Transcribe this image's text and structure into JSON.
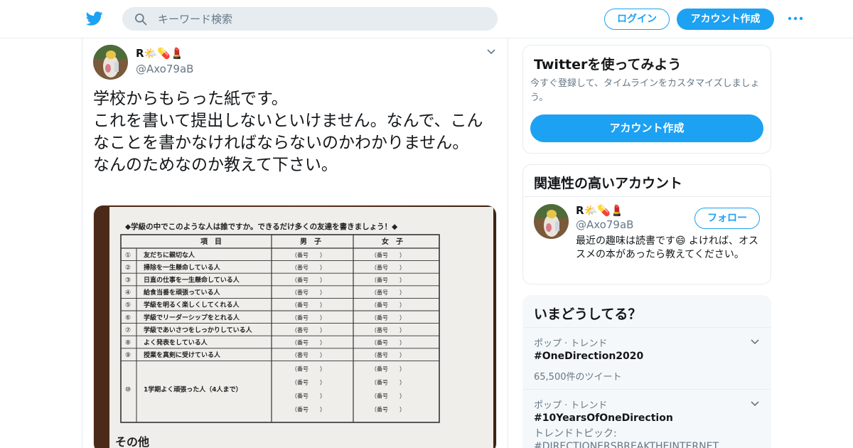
{
  "topbar": {
    "search_placeholder": "キーワード検索",
    "login_label": "ログイン",
    "signup_label": "アカウント作成"
  },
  "tweet": {
    "display_name": "R",
    "display_emojis": "🌤️💊💄",
    "handle": "@Axo79aB",
    "text": "学校からもらった紙です。\nこれを書いて提出しないといけません。なんで、こんなことを書かなければならないのかわかりません。\nなんのためなのか教えて下さい。",
    "media": {
      "title": "◆学級の中でこのような人は誰ですか。できるだけ多くの友達を書きましょう！◆",
      "col_item": "項　目",
      "col_boys": "男　子",
      "col_girls": "女　子",
      "num_label": "（番号　　）",
      "rows": [
        {
          "no": "①",
          "item": "友だちに親切な人"
        },
        {
          "no": "②",
          "item": "掃除を一生懸命している人"
        },
        {
          "no": "③",
          "item": "日直の仕事を一生懸命している人"
        },
        {
          "no": "④",
          "item": "給食当番を頑張っている人"
        },
        {
          "no": "⑤",
          "item": "学級を明るく楽しくしてくれる人"
        },
        {
          "no": "⑥",
          "item": "学級でリーダーシップをとれる人"
        },
        {
          "no": "⑦",
          "item": "学級であいさつをしっかりしている人"
        },
        {
          "no": "⑧",
          "item": "よく発表をしている人"
        },
        {
          "no": "⑨",
          "item": "授業を真剣に受けている人"
        },
        {
          "no": "⑩",
          "item": "1学期よく頑張った人（4人まで）"
        }
      ],
      "footer": "その他"
    }
  },
  "sidebar": {
    "signup_card": {
      "title": "Twitterを使ってみよう",
      "desc": "今すぐ登録して、タイムラインをカスタマイズしましょう。",
      "button": "アカウント作成"
    },
    "related_card": {
      "title": "関連性の高いアカウント",
      "name": "R",
      "emojis": "🌤️💊💄",
      "handle": "@Axo79aB",
      "follow": "フォロー",
      "bio": "最近の趣味は読書です😄 よければ、オススメの本があったら教えてください。"
    },
    "trends": {
      "title": "いまどうしてる？",
      "items": [
        {
          "context": "ポップ · トレンド",
          "name": "#OneDirection2020",
          "count": "65,500件のツイート"
        },
        {
          "context": "ポップ · トレンド",
          "name": "#10YearsOfOneDirection",
          "sub_label": "トレンドトピック:",
          "sub_value": "#DIRECTIONERSBREAKTHEINTERNET"
        }
      ]
    }
  },
  "colors": {
    "accent": "#1da1f2",
    "text": "#14171a",
    "secondary": "#657786",
    "border": "#e6ecf0"
  }
}
